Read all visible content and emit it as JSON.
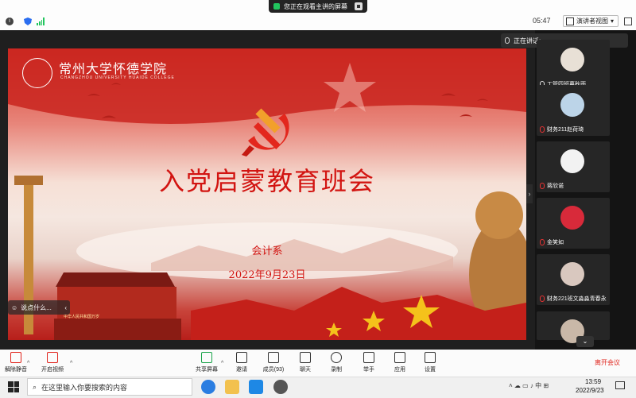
{
  "top_bar": {
    "share_notice": "您正在观看主讲的屏幕",
    "timer": "05:47",
    "view_mode": "演讲者视图"
  },
  "slide": {
    "university_name": "常州大学怀德学院",
    "university_name_en": "CHANGZHOU UNIVERSITY HUAIDE COLLEGE",
    "title": "入党启蒙教育班会",
    "department": "会计系",
    "date": "2022年9月23日",
    "gate_banner": "中华人民共和国万岁"
  },
  "reaction_bar": {
    "text": "说点什么..."
  },
  "participants": {
    "speaking_label": "正在讲话:",
    "list": [
      {
        "name": "工管四班暮秋雨",
        "mic": "on",
        "avatar_color": "#e8e0d6"
      },
      {
        "name": "财务211赵荷琦",
        "mic": "off",
        "avatar_color": "#bcd4e8"
      },
      {
        "name": "蒋欣诺",
        "mic": "off",
        "avatar_color": "#f2f2f2"
      },
      {
        "name": "金笑如",
        "mic": "off",
        "avatar_color": "#d82a3a"
      },
      {
        "name": "财务221班文淼淼青春永在跃",
        "mic": "off",
        "avatar_color": "#d9c8bf"
      },
      {
        "name": "",
        "mic": "off",
        "avatar_color": "#c9b8a8"
      }
    ]
  },
  "toolbar": {
    "items": [
      {
        "label": "解除静音",
        "icon": "mic-muted-icon"
      },
      {
        "label": "开启视频",
        "icon": "video-off-icon"
      },
      {
        "label": "共享屏幕",
        "icon": "share-screen-icon"
      },
      {
        "label": "邀请",
        "icon": "invite-icon"
      },
      {
        "label": "成员(93)",
        "icon": "members-icon"
      },
      {
        "label": "聊天",
        "icon": "chat-icon"
      },
      {
        "label": "录制",
        "icon": "record-icon"
      },
      {
        "label": "举手",
        "icon": "raise-hand-icon"
      },
      {
        "label": "应用",
        "icon": "apps-icon"
      },
      {
        "label": "设置",
        "icon": "settings-icon"
      }
    ],
    "leave_label": "离开会议"
  },
  "taskbar": {
    "search_placeholder": "在这里输入你要搜索的内容",
    "time": "13:59",
    "date": "2022/9/23",
    "tray_lang": "中"
  },
  "colors": {
    "slide_red": "#d21411",
    "leave_red": "#e0241c",
    "accent_blue": "#2b6ef0"
  }
}
